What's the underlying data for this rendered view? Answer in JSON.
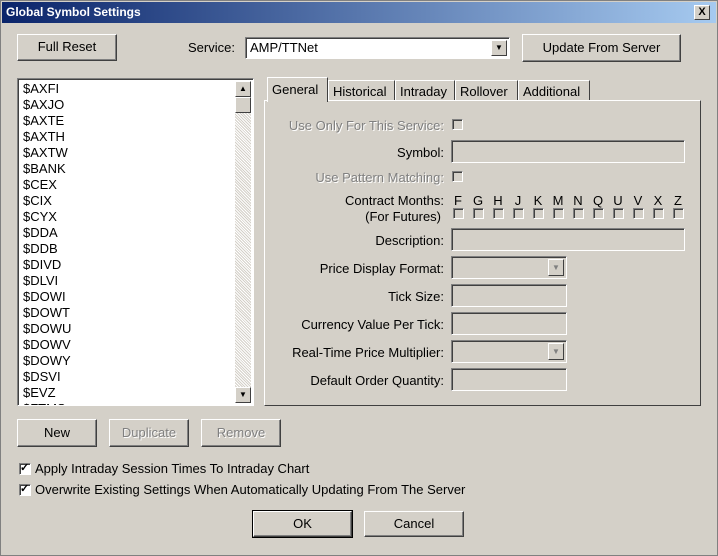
{
  "window": {
    "title": "Global Symbol Settings",
    "close_label": "X"
  },
  "top": {
    "full_reset": "Full Reset",
    "service_label": "Service:",
    "service_value": "AMP/TTNet",
    "update_from_server": "Update From Server"
  },
  "symbols": [
    "$AXFI",
    "$AXJO",
    "$AXTE",
    "$AXTH",
    "$AXTW",
    "$BANK",
    "$CEX",
    "$CIX",
    "$CYX",
    "$DDA",
    "$DDB",
    "$DIVD",
    "$DLVI",
    "$DOWI",
    "$DOWT",
    "$DOWU",
    "$DOWV",
    "$DOWY",
    "$DSVI",
    "$EVZ",
    "$FTMS"
  ],
  "tabs": [
    "General",
    "Historical",
    "Intraday",
    "Rollover",
    "Additional"
  ],
  "general": {
    "use_only_service": "Use Only For This Service:",
    "symbol": "Symbol:",
    "use_pattern": "Use Pattern Matching:",
    "contract_months": "Contract Months:",
    "for_futures": "(For Futures)",
    "months": [
      "F",
      "G",
      "H",
      "J",
      "K",
      "M",
      "N",
      "Q",
      "U",
      "V",
      "X",
      "Z"
    ],
    "description": "Description:",
    "price_display_format": "Price Display Format:",
    "tick_size": "Tick Size:",
    "currency_value": "Currency Value Per Tick:",
    "rt_multiplier": "Real-Time Price Multiplier:",
    "default_qty": "Default Order Quantity:"
  },
  "list_buttons": {
    "new": "New",
    "duplicate": "Duplicate",
    "remove": "Remove"
  },
  "options": {
    "apply_session": "Apply Intraday Session Times To Intraday Chart",
    "overwrite": "Overwrite Existing Settings When Automatically Updating From The Server"
  },
  "footer": {
    "ok": "OK",
    "cancel": "Cancel"
  }
}
